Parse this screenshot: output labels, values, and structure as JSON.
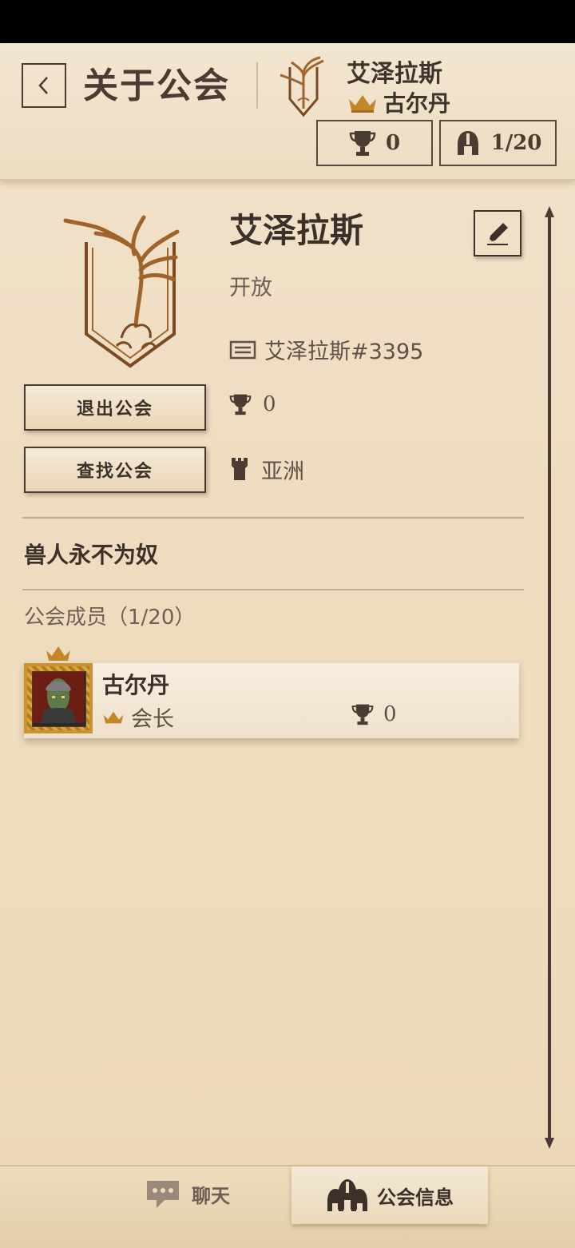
{
  "header": {
    "back_icon": "chevron-left-icon",
    "title": "关于公会",
    "guild_name": "艾泽拉斯",
    "leader_name": "古尔丹",
    "trophies": "0",
    "members": "1/20"
  },
  "guild": {
    "name": "艾泽拉斯",
    "status": "开放",
    "tag": "艾泽拉斯#3395",
    "trophies": "0",
    "region": "亚洲",
    "motto": "兽人永不为奴"
  },
  "buttons": {
    "leave": "退出公会",
    "find": "查找公会"
  },
  "members_section": {
    "header": "公会成员（1/20）",
    "members": [
      {
        "name": "古尔丹",
        "role": "会长",
        "trophies": "0"
      }
    ]
  },
  "tabs": {
    "chat": "聊天",
    "guild_info": "公会信息"
  },
  "colors": {
    "accent_gold": "#c9932f",
    "text_dark": "#3b302a",
    "parchment": "#efdcc0"
  }
}
